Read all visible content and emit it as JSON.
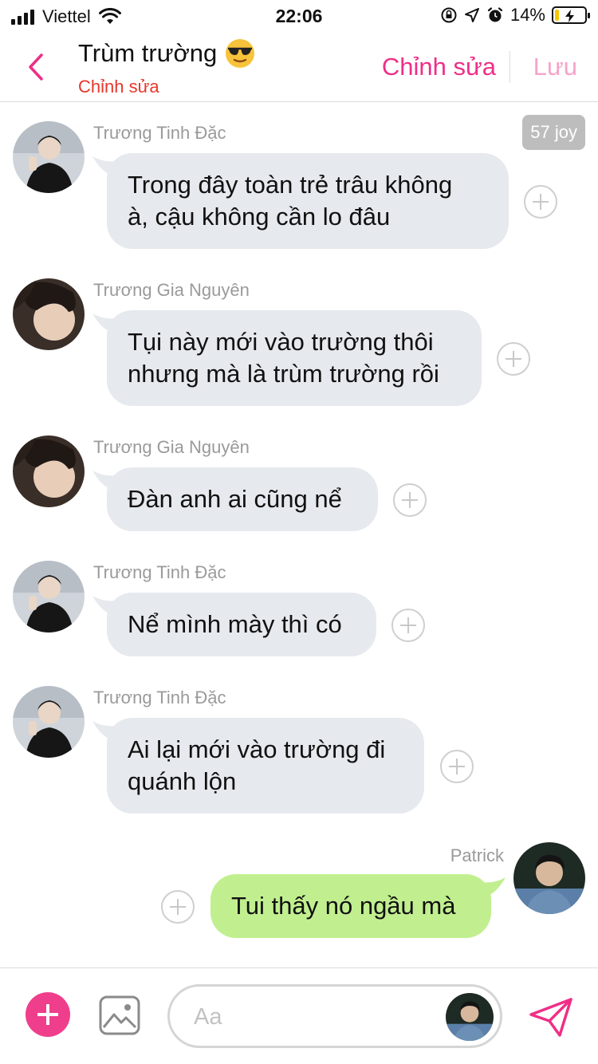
{
  "status_bar": {
    "carrier": "Viettel",
    "time": "22:06",
    "battery_percent": "14%",
    "battery_level": 0.14,
    "icons": [
      "signal-icon",
      "wifi-icon",
      "orientation-lock-icon",
      "location-icon",
      "alarm-icon",
      "battery-charging-icon"
    ]
  },
  "header": {
    "title": "Trùm trường",
    "title_emoji": "sunglasses-face",
    "subtitle": "Chỉnh sửa",
    "edit_label": "Chỉnh sửa",
    "save_label": "Lưu"
  },
  "joy_badge": "57 joy",
  "messages": [
    {
      "sender": "Trương Tinh Đặc",
      "direction": "incoming",
      "lines": [
        "Trong đây toàn trẻ trâu không",
        "à, cậu không cần lo đâu"
      ]
    },
    {
      "sender": "Trương Gia Nguyên",
      "direction": "incoming",
      "lines": [
        "Tụi này mới vào trường thôi",
        "nhưng mà là trùm trường rồi"
      ]
    },
    {
      "sender": "Trương Gia Nguyên",
      "direction": "incoming",
      "lines": [
        "Đàn anh ai cũng nể"
      ]
    },
    {
      "sender": "Trương Tinh Đặc",
      "direction": "incoming",
      "lines": [
        "Nể mình mày thì có"
      ]
    },
    {
      "sender": "Trương Tinh Đặc",
      "direction": "incoming",
      "lines": [
        "Ai lại mới vào trường đi",
        "quánh lộn"
      ]
    },
    {
      "sender": "Patrick",
      "direction": "outgoing",
      "lines": [
        "Tui thấy nó ngầu mà"
      ]
    }
  ],
  "input": {
    "placeholder": "Aa"
  },
  "colors": {
    "accent_pink": "#ef2f86",
    "subtitle_red": "#e8362b",
    "incoming_bubble": "#e6e9ed",
    "outgoing_bubble": "#c1ef8f"
  }
}
